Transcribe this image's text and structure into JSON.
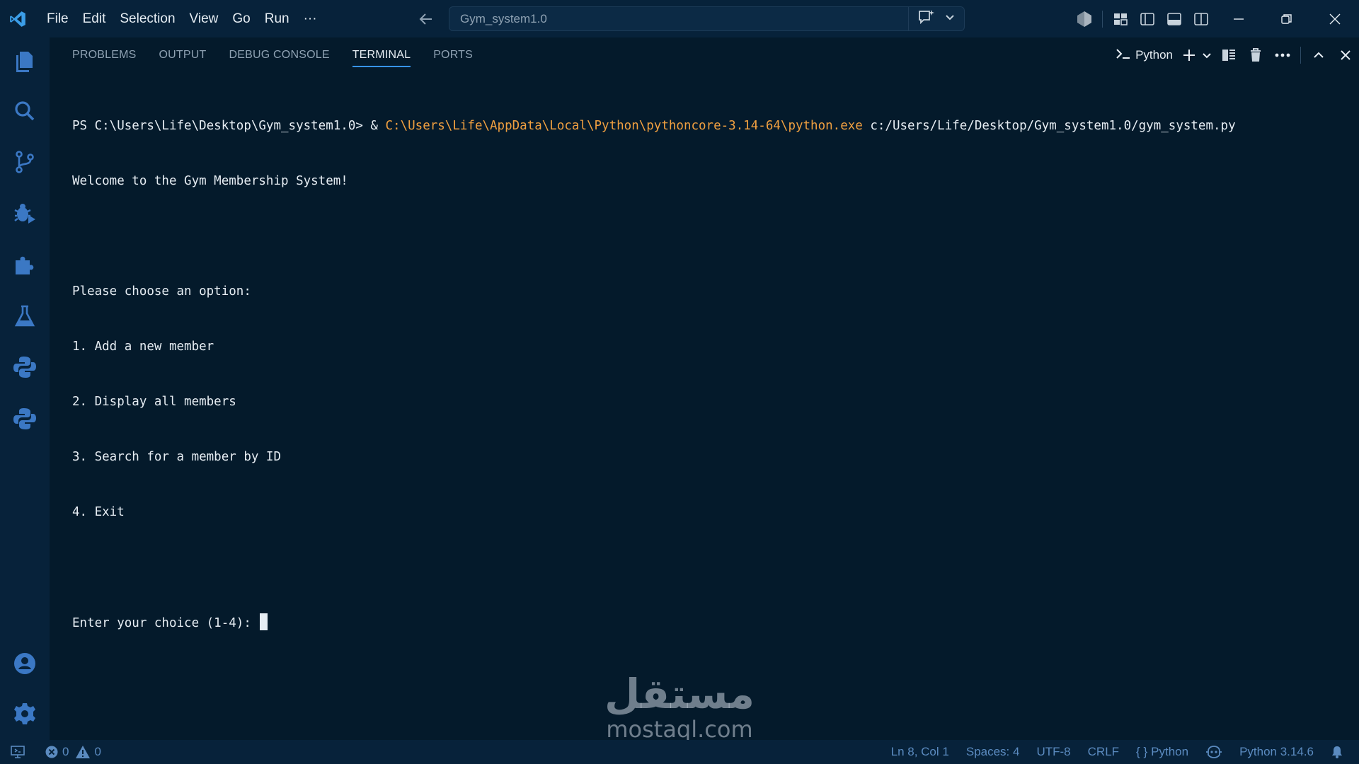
{
  "titlebar": {
    "menu": [
      "File",
      "Edit",
      "Selection",
      "View",
      "Go",
      "Run",
      "···"
    ],
    "search_text": "Gym_system1.0"
  },
  "panel": {
    "tabs": [
      "PROBLEMS",
      "OUTPUT",
      "DEBUG CONSOLE",
      "TERMINAL",
      "PORTS"
    ],
    "active_tab": "TERMINAL",
    "terminal_name": "Python"
  },
  "terminal": {
    "prompt": "PS C:\\Users\\Life\\Desktop\\Gym_system1.0> & ",
    "exe_path": "C:\\Users\\Life\\AppData\\Local\\Python\\pythoncore-3.14-64\\python.exe",
    "script_path": " c:/Users/Life/Desktop/Gym_system1.0/gym_system.py",
    "lines": [
      "Welcome to the Gym Membership System!",
      "",
      "Please choose an option:",
      "1. Add a new member",
      "2. Display all members",
      "3. Search for a member by ID",
      "4. Exit",
      ""
    ],
    "input_prompt": "Enter your choice (1-4): "
  },
  "watermark": {
    "arabic": "مستقل",
    "latin": "mostaql.com"
  },
  "statusbar": {
    "errors": "0",
    "warnings": "0",
    "position": "Ln 8, Col 1",
    "spaces": "Spaces: 4",
    "encoding": "UTF-8",
    "eol": "CRLF",
    "language": "Python",
    "interpreter": "Python 3.14.6"
  },
  "colors": {
    "background": "#041a2b",
    "chrome": "#07223a",
    "accent": "#3794ff",
    "path_highlight": "#f0a040",
    "status_text": "#5b8bc0"
  }
}
